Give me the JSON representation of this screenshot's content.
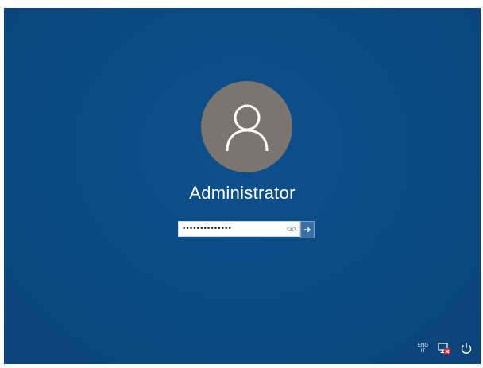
{
  "screen": {
    "background_color": "#0b4a82"
  },
  "user": {
    "avatar_icon": "user-silhouette-icon",
    "name": "Administrator"
  },
  "password": {
    "masked_value": "••••••••••••••",
    "reveal_icon": "eye-icon",
    "submit_icon": "arrow-right-icon"
  },
  "tray": {
    "language_code": "ENG",
    "language_layout": "IT",
    "network_icon": "network-disconnected-icon",
    "power_icon": "power-icon"
  }
}
